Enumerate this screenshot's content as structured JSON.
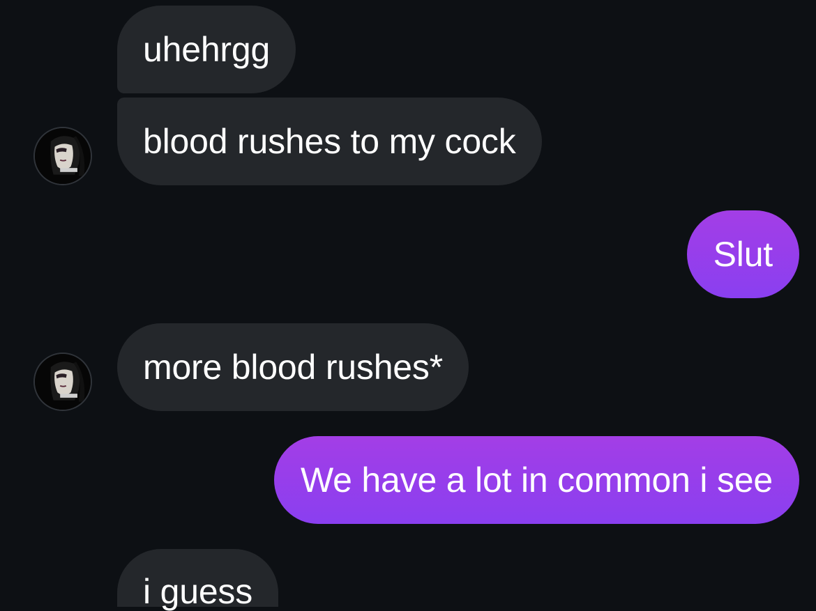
{
  "messages": [
    {
      "id": "m1",
      "direction": "incoming",
      "text": "uhehrgg"
    },
    {
      "id": "m2",
      "direction": "incoming",
      "text": "blood rushes to my cock"
    },
    {
      "id": "m3",
      "direction": "outgoing",
      "text": "Slut"
    },
    {
      "id": "m4",
      "direction": "incoming",
      "text": "more blood rushes*"
    },
    {
      "id": "m5",
      "direction": "outgoing",
      "text": "We have a lot in common i see"
    },
    {
      "id": "m6",
      "direction": "incoming",
      "text": "i guess"
    }
  ],
  "colors": {
    "background": "#0d1014",
    "incoming_bubble": "#24272b",
    "outgoing_bubble": "#9140ec",
    "text": "#ffffff"
  },
  "icons": {
    "avatar": "avatar-icon"
  }
}
